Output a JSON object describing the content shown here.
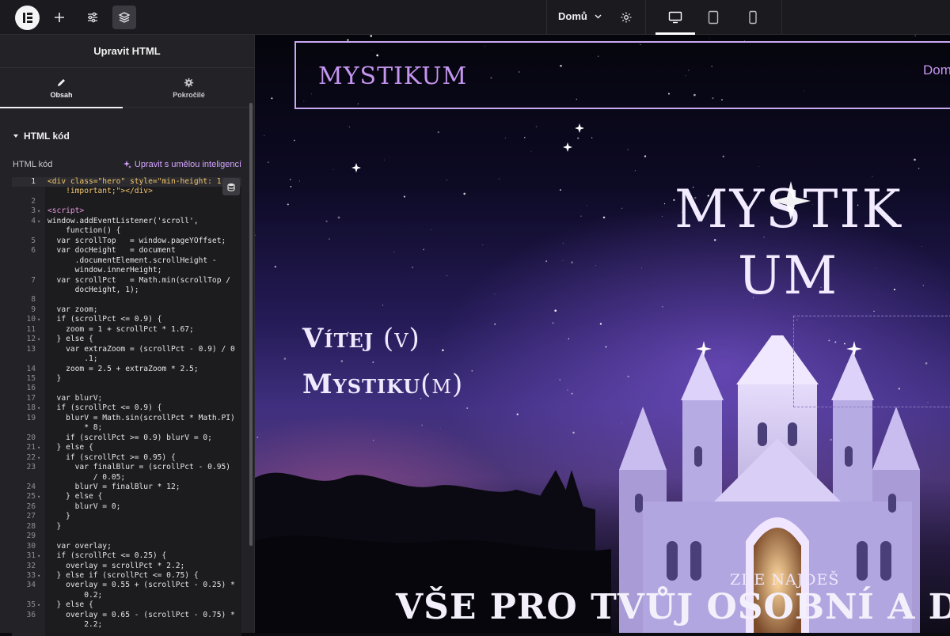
{
  "topbar": {
    "page_name": "Domů"
  },
  "panel": {
    "title": "Upravit HTML",
    "tabs": [
      {
        "label": "Obsah",
        "icon": "pencil-icon"
      },
      {
        "label": "Pokročilé",
        "icon": "gear-icon"
      }
    ],
    "section_title": "HTML kód",
    "field_label": "HTML kód",
    "ai_link": "Upravit s umělou inteligencí"
  },
  "code": [
    {
      "n": "1",
      "fold": "",
      "text": "<div class=\"hero\" style=\"min-height: 1"
    },
    {
      "n": "",
      "fold": "",
      "text": "    !important;\"></div>"
    },
    {
      "n": "2",
      "fold": "",
      "text": ""
    },
    {
      "n": "3",
      "fold": "▾",
      "text": "<script>"
    },
    {
      "n": "4",
      "fold": "▾",
      "text": "window.addEventListener('scroll',"
    },
    {
      "n": "",
      "fold": "",
      "text": "    function() {"
    },
    {
      "n": "5",
      "fold": "",
      "text": "  var scrollTop   = window.pageYOffset;"
    },
    {
      "n": "6",
      "fold": "",
      "text": "  var docHeight   = document"
    },
    {
      "n": "",
      "fold": "",
      "text": "      .documentElement.scrollHeight -"
    },
    {
      "n": "",
      "fold": "",
      "text": "      window.innerHeight;"
    },
    {
      "n": "7",
      "fold": "",
      "text": "  var scrollPct   = Math.min(scrollTop /"
    },
    {
      "n": "",
      "fold": "",
      "text": "      docHeight, 1);"
    },
    {
      "n": "8",
      "fold": "",
      "text": ""
    },
    {
      "n": "9",
      "fold": "",
      "text": "  var zoom;"
    },
    {
      "n": "10",
      "fold": "▾",
      "text": "  if (scrollPct <= 0.9) {"
    },
    {
      "n": "11",
      "fold": "",
      "text": "    zoom = 1 + scrollPct * 1.67;"
    },
    {
      "n": "12",
      "fold": "▾",
      "text": "  } else {"
    },
    {
      "n": "13",
      "fold": "",
      "text": "    var extraZoom = (scrollPct - 0.9) / 0"
    },
    {
      "n": "",
      "fold": "",
      "text": "        .1;"
    },
    {
      "n": "14",
      "fold": "",
      "text": "    zoom = 2.5 + extraZoom * 2.5;"
    },
    {
      "n": "15",
      "fold": "",
      "text": "  }"
    },
    {
      "n": "16",
      "fold": "",
      "text": ""
    },
    {
      "n": "17",
      "fold": "",
      "text": "  var blurV;"
    },
    {
      "n": "18",
      "fold": "▾",
      "text": "  if (scrollPct <= 0.9) {"
    },
    {
      "n": "19",
      "fold": "",
      "text": "    blurV = Math.sin(scrollPct * Math.PI)"
    },
    {
      "n": "",
      "fold": "",
      "text": "        * 8;"
    },
    {
      "n": "20",
      "fold": "",
      "text": "    if (scrollPct >= 0.9) blurV = 0;"
    },
    {
      "n": "21",
      "fold": "▾",
      "text": "  } else {"
    },
    {
      "n": "22",
      "fold": "▾",
      "text": "    if (scrollPct >= 0.95) {"
    },
    {
      "n": "23",
      "fold": "",
      "text": "      var finalBlur = (scrollPct - 0.95)"
    },
    {
      "n": "",
      "fold": "",
      "text": "          / 0.05;"
    },
    {
      "n": "24",
      "fold": "",
      "text": "      blurV = finalBlur * 12;"
    },
    {
      "n": "25",
      "fold": "▾",
      "text": "    } else {"
    },
    {
      "n": "26",
      "fold": "",
      "text": "      blurV = 0;"
    },
    {
      "n": "27",
      "fold": "",
      "text": "    }"
    },
    {
      "n": "28",
      "fold": "",
      "text": "  }"
    },
    {
      "n": "29",
      "fold": "",
      "text": ""
    },
    {
      "n": "30",
      "fold": "",
      "text": "  var overlay;"
    },
    {
      "n": "31",
      "fold": "▾",
      "text": "  if (scrollPct <= 0.25) {"
    },
    {
      "n": "32",
      "fold": "",
      "text": "    overlay = scrollPct * 2.2;"
    },
    {
      "n": "33",
      "fold": "▾",
      "text": "  } else if (scrollPct <= 0.75) {"
    },
    {
      "n": "34",
      "fold": "",
      "text": "    overlay = 0.55 + (scrollPct - 0.25) *"
    },
    {
      "n": "",
      "fold": "",
      "text": "        0.2;"
    },
    {
      "n": "35",
      "fold": "▾",
      "text": "  } else {"
    },
    {
      "n": "36",
      "fold": "",
      "text": "    overlay = 0.65 - (scrollPct - 0.75) *"
    },
    {
      "n": "",
      "fold": "",
      "text": "        2.2;"
    }
  ],
  "site": {
    "logo_text": "MYSTIKUM",
    "nav_home": "Domů",
    "hero_logo_line1": "MYSTIK",
    "hero_logo_line2": "UM",
    "hero_title_1": "Vítej",
    "hero_title_1_paren": " (v)",
    "hero_title_2": "Mystiku",
    "hero_title_2_paren": "(m)",
    "tagline_small": "ZDE NAJDEŠ",
    "tagline_big": "VŠE PRO TVŮJ OSOBNÍ A DUCH"
  },
  "colors": {
    "accent": "#c596f0",
    "ai_link": "#d4a3ff",
    "header_border": "#c9a8f2"
  }
}
